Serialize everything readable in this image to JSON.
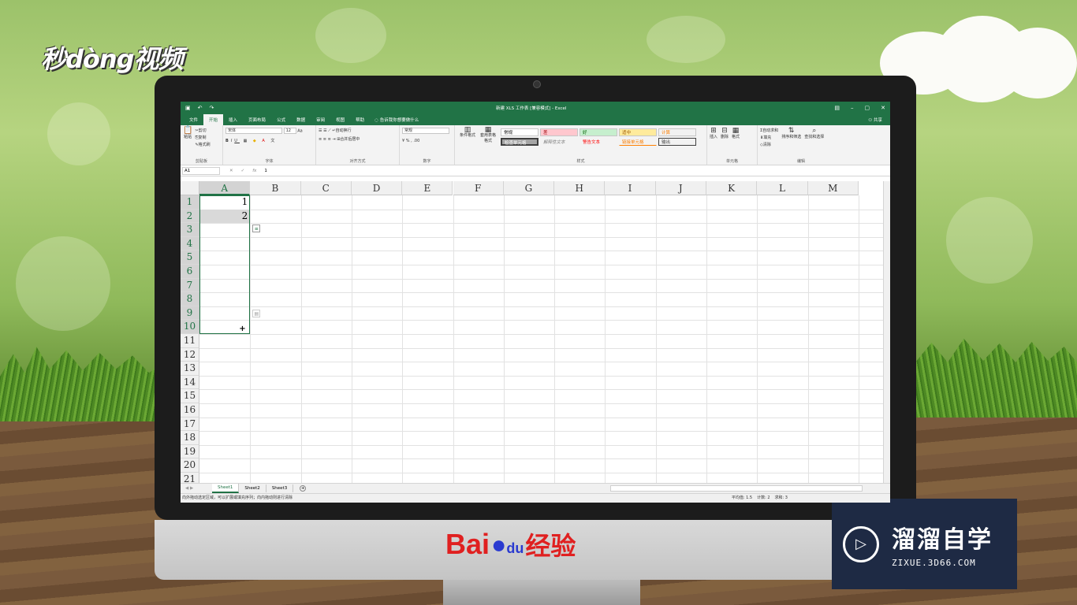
{
  "brand_top_left": "秒dòng视频",
  "baidu": {
    "bai": "Bai",
    "du": "du",
    "jingyan": "经验"
  },
  "watermark": {
    "title": "溜溜自学",
    "subtitle": "ZIXUE.3D66.COM"
  },
  "excel": {
    "window_title": "新建 XLS 工作表 [兼容模式] - Excel",
    "tabs": [
      "文件",
      "开始",
      "插入",
      "页面布局",
      "公式",
      "数据",
      "审阅",
      "视图",
      "帮助"
    ],
    "active_tab": "开始",
    "tell_me": "告诉我你想要做什么",
    "share": "共享",
    "ribbon": {
      "clipboard": {
        "paste": "粘贴",
        "cut": "剪切",
        "copy": "复制",
        "format_painter": "格式刷",
        "label": "剪贴板"
      },
      "font": {
        "name": "宋体",
        "size": "12",
        "label": "字体"
      },
      "alignment": {
        "wrap": "自动换行",
        "merge": "合并后居中",
        "label": "对齐方式"
      },
      "number": {
        "format": "常规",
        "label": "数字"
      },
      "styles": {
        "conditional": "条件格式",
        "table": "套用表格格式",
        "cells": [
          "常规",
          "差",
          "好",
          "适中",
          "计算",
          "检查单元格",
          "解释性文本",
          "警告文本",
          "链接单元格",
          "输出"
        ],
        "label": "样式"
      },
      "cells_group": {
        "insert": "插入",
        "delete": "删除",
        "format": "格式",
        "label": "单元格"
      },
      "editing": {
        "autosum": "自动求和",
        "fill": "填充",
        "clear": "清除",
        "sort": "排序和筛选",
        "find": "查找和选择",
        "label": "编辑"
      }
    },
    "name_box": "A1",
    "formula_value": "1",
    "columns": [
      "A",
      "B",
      "C",
      "D",
      "E",
      "F",
      "G",
      "H",
      "I",
      "J",
      "K",
      "L",
      "M"
    ],
    "rows": [
      "1",
      "2",
      "3",
      "4",
      "5",
      "6",
      "7",
      "8",
      "9",
      "10",
      "11",
      "12",
      "13",
      "14",
      "15",
      "16",
      "17",
      "18",
      "19",
      "20",
      "21"
    ],
    "cells": {
      "A1": "1",
      "A2": "2"
    },
    "sheets": [
      "Sheet1",
      "Sheet2",
      "Sheet3"
    ],
    "active_sheet": "Sheet1",
    "status_text": "向外拖动选定区域，可以扩展或填充序列；向内拖动则进行清除",
    "status_stats": {
      "average": "平均值: 1.5",
      "count": "计数: 2",
      "sum": "求和: 3"
    }
  }
}
